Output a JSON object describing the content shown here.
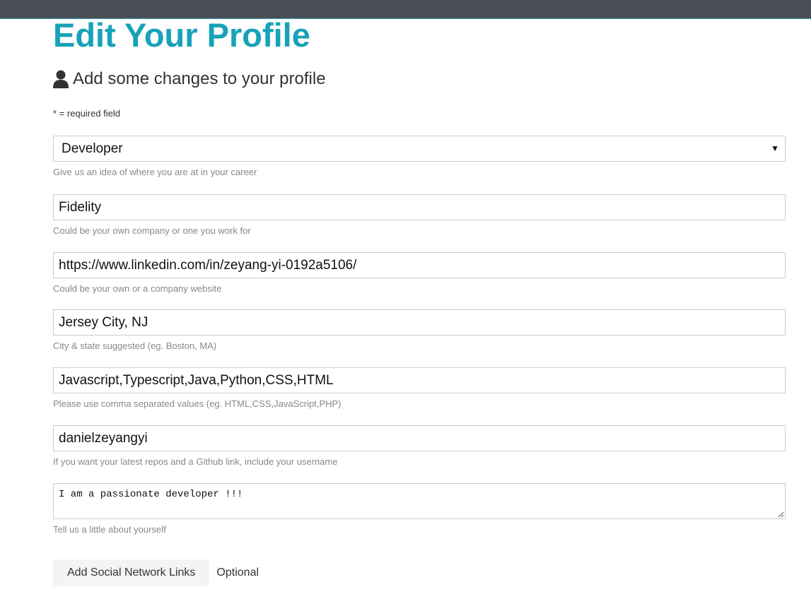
{
  "header": {
    "title": "Edit Your Profile",
    "lead_icon": "user-icon",
    "lead_text": "Add some changes to your profile",
    "required_note": "* = required field"
  },
  "form": {
    "status": {
      "value": "Developer",
      "hint": "Give us an idea of where you are at in your career"
    },
    "company": {
      "value": "Fidelity",
      "hint": "Could be your own company or one you work for"
    },
    "website": {
      "value": "https://www.linkedin.com/in/zeyang-yi-0192a5106/",
      "hint": "Could be your own or a company website"
    },
    "location": {
      "value": "Jersey City, NJ",
      "hint": "City & state suggested (eg. Boston, MA)"
    },
    "skills": {
      "value": "Javascript,Typescript,Java,Python,CSS,HTML",
      "hint": "Please use comma separated values (eg. HTML,CSS,JavaScript,PHP)"
    },
    "github": {
      "value": "danielzeyangyi",
      "hint": "If you want your latest repos and a Github link, include your username"
    },
    "bio": {
      "value": "I am a passionate developer !!!",
      "hint": "Tell us a little about yourself"
    }
  },
  "social": {
    "button_label": "Add Social Network Links",
    "optional_label": "Optional"
  },
  "colors": {
    "accent": "#17a2b8",
    "topbar": "#4a4f57"
  }
}
